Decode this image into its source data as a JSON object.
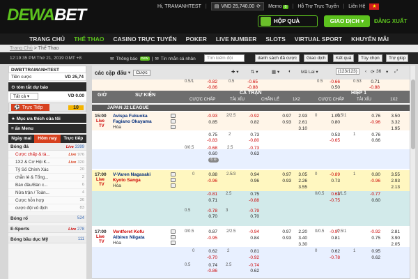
{
  "brand": {
    "logo_a": "DEWA",
    "logo_b": "BET"
  },
  "top": {
    "greeting": "Hi, TRAMANHTEST",
    "balance": "VND 25,740.00",
    "memo": "Memo",
    "memo_count": "8",
    "support": "Hỗ Trợ Trực Tuyến",
    "contact": "Liên Hệ",
    "flag": "★",
    "gift": "HỘP QUÀ",
    "transaction": "GIAO DỊCH",
    "logout": "ĐĂNG XUẤT"
  },
  "nav": [
    "TRANG CHỦ",
    "THỂ THAO",
    "CASINO TRỰC TUYẾN",
    "POKER",
    "LIVE NUMBER",
    "SLOTS",
    "VIRTUAL SPORT",
    "KHUYẾN MÃI"
  ],
  "breadcrumb": {
    "home": "Trang Chủ",
    "current": "Thể Thao"
  },
  "subbar": {
    "time": "12:19:35 PM Thứ 21, 2019 GMT +8",
    "notice": "Thông báo",
    "new": "new",
    "personal": "Tin nhắn cá nhân",
    "search_placeholder": "Tìm kiếm đội",
    "buttons": [
      "danh sách đã cược",
      "Giao dịch",
      "Kết quả",
      "Tùy chọn",
      "Trợ giúp"
    ]
  },
  "left": {
    "user": "DWBTTRAMANHTEST",
    "cash_label": "Tiền cược",
    "cash_value": "VD 25,74",
    "summary": "tóm tắt dự báo",
    "summary_value": "VD 0.00",
    "select": "Tất cả",
    "live_label": "Trực Tiếp",
    "live_count": "10",
    "fav": "Mục ưa thích của tôi",
    "menu": "ẩn Menu",
    "tabs": [
      "Ngày mai",
      "Hôm nay",
      "Trực tiếp"
    ],
    "sports": [
      {
        "name": "Bóng đá",
        "live": "Live",
        "count": "3399"
      },
      {
        "name": "Bóng rổ",
        "live": "",
        "count": "524"
      },
      {
        "name": "E-Sports",
        "live": "Live",
        "count": "278"
      },
      {
        "name": "Bóng bầu dục Mỹ",
        "live": "",
        "count": "111"
      }
    ],
    "subs": [
      {
        "name": "Cược chấp & tà...",
        "live": "Live",
        "count": "976"
      },
      {
        "name": "1X2 & Cơ Hội K...",
        "live": "Live",
        "count": "320"
      },
      {
        "name": "Tỷ Số Chính Xác",
        "live": "",
        "count": "20"
      },
      {
        "name": "chẵn lẻ & Tổng...",
        "live": "",
        "count": "2"
      },
      {
        "name": "Bàn đầu/Bàn c...",
        "live": "",
        "count": "6"
      },
      {
        "name": "Nửa trận / Toàn...",
        "live": "",
        "count": "4"
      },
      {
        "name": "Cược hỗn hợp",
        "live": "",
        "count": "36"
      },
      {
        "name": "cược đội vô địch",
        "live": "",
        "count": "83"
      }
    ]
  },
  "toolbar": {
    "title": "các cặp đấu",
    "button": "Cược",
    "filter": "Mã Lai",
    "pages": "123/123",
    "count": "36"
  },
  "headers": {
    "gio": "GIỜ",
    "sukien": "SỰ KIỆN",
    "catran": "CẢ TRẬN",
    "hiep": "HIỆP 1",
    "cols": [
      "CƯỢC CHẤP",
      "TÀI XỈU",
      "CHẴN LẺ",
      "1X2",
      "CƯỢC CHẤP",
      "TÀI XỈU",
      "1X2"
    ]
  },
  "league": "JAPAN J2 LEAGUE",
  "prev": [
    {
      "h": "0.5/1",
      "o1": "-0.82",
      "o2": "0.5",
      "o3": "-0.65",
      "h2": "0.5",
      "o4": "-0.66",
      "o5": "0.53",
      "o6": "0.71"
    },
    {
      "h": "",
      "o1": "-0.86",
      "o2": "",
      "o3": "-0.88",
      "h2": "",
      "o4": "0.50",
      "o5": "",
      "o6": "-0.88"
    }
  ],
  "matches": [
    {
      "time": "15:00",
      "live": "Live",
      "tv": "TV",
      "home": "Avispa Fukuoka",
      "away": "Fagiano Okayama",
      "draw": "Hòa"
    },
    {
      "time": "17:00",
      "live": "Live",
      "tv": "TV",
      "home": "V-Varen Nagasaki",
      "away": "Kyoto Sanga",
      "draw": "Hòa"
    },
    {
      "time": "17:00",
      "live": "Live",
      "tv": "TV",
      "home": "Ventforet Kofu",
      "away": "Albirex Niigata",
      "draw": "Hòa"
    }
  ]
}
